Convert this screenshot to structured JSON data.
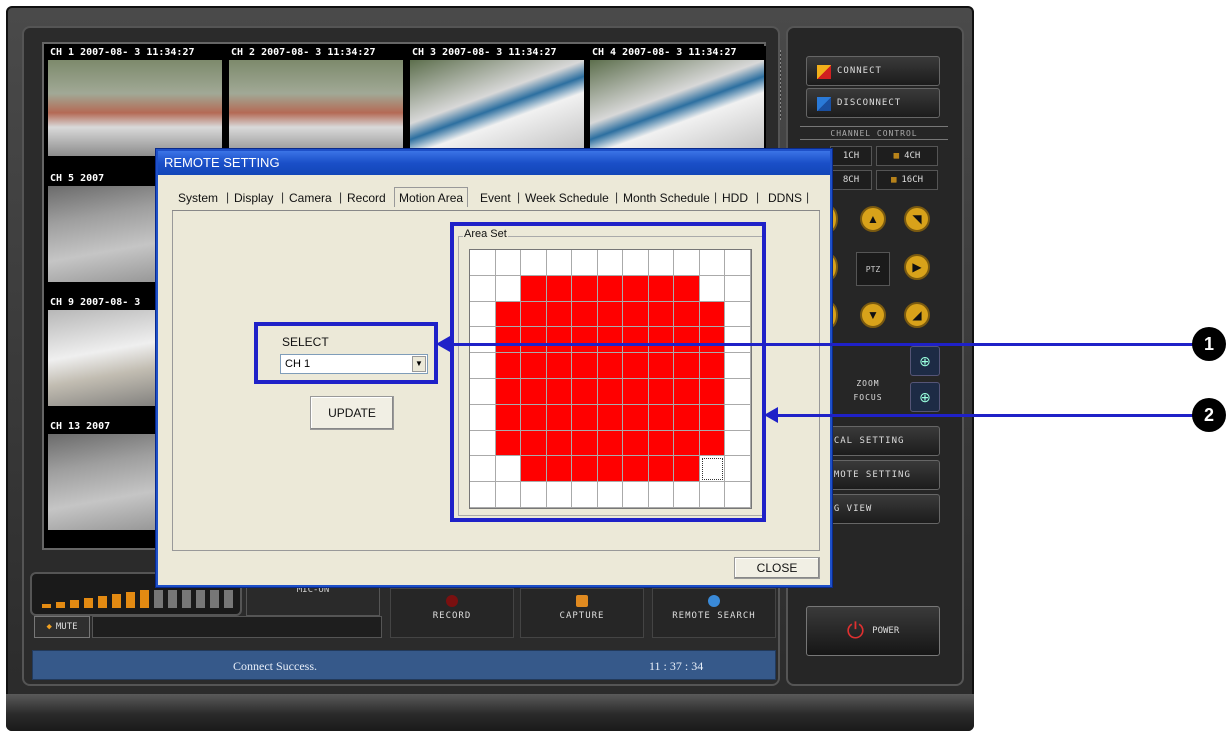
{
  "cameras": [
    {
      "title": "CH 1 2007-08- 3 11:34:27"
    },
    {
      "title": "CH 2 2007-08- 3 11:34:27"
    },
    {
      "title": "CH 3 2007-08- 3 11:34:27"
    },
    {
      "title": "CH 4 2007-08- 3 11:34:27"
    },
    {
      "title": "CH 5 2007"
    },
    {
      "title": "CH 9 2007-08- 3"
    },
    {
      "title": "CH 13 2007"
    }
  ],
  "right_panel": {
    "connect": "CONNECT",
    "disconnect": "DISCONNECT",
    "channel_control": "CHANNEL CONTROL",
    "ch1": "1CH",
    "ch4": "4CH",
    "ch8": "8CH",
    "ch16": "16CH",
    "ptz": "PTZ",
    "zoom": "ZOOM",
    "focus": "FOCUS",
    "local_setting": "LOCAL SETTING",
    "remote_setting": "REMOTE SETTING",
    "log_view": "LOG VIEW",
    "power": "POWER"
  },
  "bottom_controls": {
    "mute": "MUTE",
    "mic": "MIC-ON",
    "record": "RECORD",
    "capture": "CAPTURE",
    "remote_search": "REMOTE SEARCH",
    "levels_lit": 8,
    "levels_total": 14
  },
  "status": {
    "message": "Connect Success.",
    "time": "11 : 37 : 34"
  },
  "dialog": {
    "title": "REMOTE SETTING",
    "tabs": [
      "System",
      "Display",
      "Camera",
      "Record",
      "Motion Area",
      "Event",
      "Week Schedule",
      "Month Schedule",
      "HDD",
      "DDNS"
    ],
    "active_tab": "Motion Area",
    "select_label": "SELECT",
    "select_value": "CH 1",
    "update": "UPDATE",
    "area_set": "Area Set",
    "close": "CLOSE",
    "grid_rows": [
      [
        0,
        0,
        0,
        0,
        0,
        0,
        0,
        0,
        0,
        0,
        0
      ],
      [
        0,
        0,
        1,
        1,
        1,
        1,
        1,
        1,
        1,
        0,
        0
      ],
      [
        0,
        1,
        1,
        1,
        1,
        1,
        1,
        1,
        1,
        1,
        0
      ],
      [
        0,
        1,
        1,
        1,
        1,
        1,
        1,
        1,
        1,
        1,
        0
      ],
      [
        0,
        1,
        1,
        1,
        1,
        1,
        1,
        1,
        1,
        1,
        0
      ],
      [
        0,
        1,
        1,
        1,
        1,
        1,
        1,
        1,
        1,
        1,
        0
      ],
      [
        0,
        1,
        1,
        1,
        1,
        1,
        1,
        1,
        1,
        1,
        0
      ],
      [
        0,
        1,
        1,
        1,
        1,
        1,
        1,
        1,
        1,
        1,
        0
      ],
      [
        0,
        0,
        1,
        1,
        1,
        1,
        1,
        1,
        1,
        0,
        0
      ],
      [
        0,
        0,
        0,
        0,
        0,
        0,
        0,
        0,
        0,
        0,
        0
      ]
    ],
    "cursor_cell": [
      8,
      9
    ]
  },
  "callouts": [
    "1",
    "2"
  ],
  "colors": {
    "highlight": "#1f21c8",
    "motion_on": "#ff0000",
    "status_bar": "#36598a",
    "dialog_title": "#1a4fc8"
  }
}
